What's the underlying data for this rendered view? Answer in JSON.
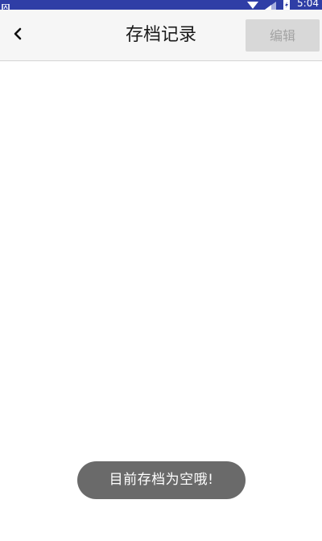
{
  "status_bar": {
    "time": "5:04",
    "color": "#2f3ea6",
    "icons": [
      "notification-icon",
      "wifi-icon",
      "signal-icon",
      "battery-icon"
    ]
  },
  "header": {
    "back_icon": "chevron-left-icon",
    "title": "存档记录",
    "edit_label": "编辑",
    "edit_enabled": false
  },
  "content": {
    "items": []
  },
  "toast": {
    "message": "目前存档为空哦!"
  }
}
